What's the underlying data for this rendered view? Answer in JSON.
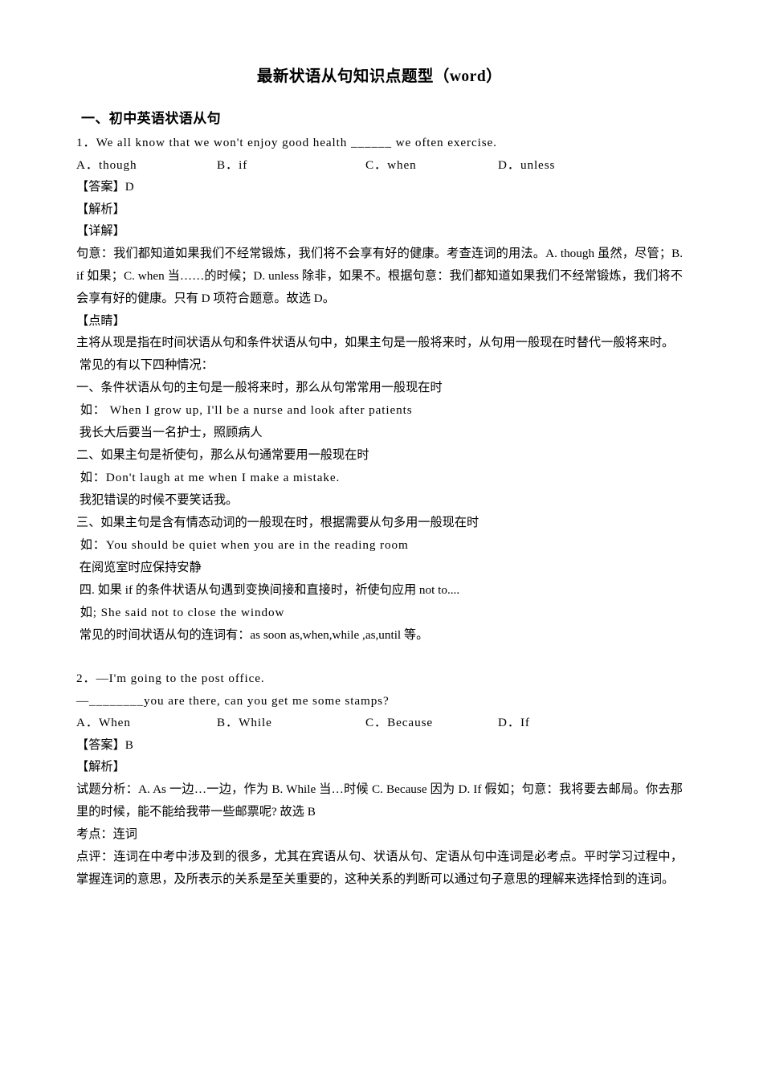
{
  "document": {
    "title": "最新状语从句知识点题型（word）",
    "section_heading": "一、初中英语状语从句",
    "blocks": [
      {
        "id": "q1_stem",
        "text": "1．We all know that we won't enjoy good health ______ we often exercise."
      },
      {
        "id": "q1_opt_a",
        "text": "A．though"
      },
      {
        "id": "q1_opt_b",
        "text": "B．if"
      },
      {
        "id": "q1_opt_c",
        "text": "C．when"
      },
      {
        "id": "q1_opt_d",
        "text": "D．unless"
      },
      {
        "id": "q1_answer",
        "text": "【答案】D"
      },
      {
        "id": "q1_analysis_label",
        "text": "【解析】"
      },
      {
        "id": "q1_detail_label",
        "text": "【详解】"
      },
      {
        "id": "q1_detail_text",
        "text": "句意：我们都知道如果我们不经常锻炼，我们将不会享有好的健康。考查连词的用法。A. though 虽然，尽管；B. if 如果；C. when 当……的时候；D. unless 除非，如果不。根据句意：我们都知道如果我们不经常锻炼，我们将不会享有好的健康。只有 D 项符合题意。故选 D。"
      },
      {
        "id": "q1_point_label",
        "text": "【点睛】"
      },
      {
        "id": "q1_point_text",
        "text": "主将从现是指在时间状语从句和条件状语从句中，如果主句是一般将来时，从句用一般现在时替代一般将来时。"
      },
      {
        "id": "q1_cases_intro",
        "text": " 常见的有以下四种情况："
      },
      {
        "id": "case1",
        "text": "一、条件状语从句的主句是一般将来时，那么从句常常用一般现在时"
      },
      {
        "id": "case1_eg",
        "text": " 如： When I grow up, I'll be a nurse and look after patients"
      },
      {
        "id": "case1_eg_cn",
        "text": " 我长大后要当一名护士，照顾病人"
      },
      {
        "id": "case2",
        "text": "二、如果主句是祈使句，那么从句通常要用一般现在时"
      },
      {
        "id": "case2_eg",
        "text": " 如：Don't laugh at me when I make a mistake."
      },
      {
        "id": "case2_eg_cn",
        "text": " 我犯错误的时候不要笑话我。"
      },
      {
        "id": "case3",
        "text": "三、如果主句是含有情态动词的一般现在时，根据需要从句多用一般现在时"
      },
      {
        "id": "case3_eg",
        "text": " 如：You should be quiet when you are in the reading room"
      },
      {
        "id": "case3_eg_cn",
        "text": " 在阅览室时应保持安静"
      },
      {
        "id": "case4",
        "text": " 四. 如果 if 的条件状语从句遇到变换间接和直接时，祈使句应用 not to...."
      },
      {
        "id": "case4_eg",
        "text": " 如; She said not to close the window"
      },
      {
        "id": "case_summary",
        "text": " 常见的时间状语从句的连词有：as soon as,when,while ,as,until 等。"
      },
      {
        "id": "q2_stem1",
        "text": "2．—I'm going to the post office."
      },
      {
        "id": "q2_stem2",
        "text": "—________you are there, can you get me some stamps?"
      },
      {
        "id": "q2_opt_a",
        "text": "A．When"
      },
      {
        "id": "q2_opt_b",
        "text": "B．While"
      },
      {
        "id": "q2_opt_c",
        "text": "C．Because"
      },
      {
        "id": "q2_opt_d",
        "text": "D．If"
      },
      {
        "id": "q2_answer",
        "text": "【答案】B"
      },
      {
        "id": "q2_analysis_label",
        "text": "【解析】"
      },
      {
        "id": "q2_analysis_text",
        "text": "试题分析：A. As 一边…一边，作为 B. While 当…时候 C. Because 因为 D. If 假如；句意：我将要去邮局。你去那里的时候，能不能给我带一些邮票呢? 故选 B"
      },
      {
        "id": "q2_kaodian",
        "text": "考点：连词"
      },
      {
        "id": "q2_dianping",
        "text": "点评：连词在中考中涉及到的很多，尤其在宾语从句、状语从句、定语从句中连词是必考点。平时学习过程中，掌握连词的意思，及所表示的关系是至关重要的，这种关系的判断可以通过句子意思的理解来选择恰到的连词。"
      }
    ]
  }
}
